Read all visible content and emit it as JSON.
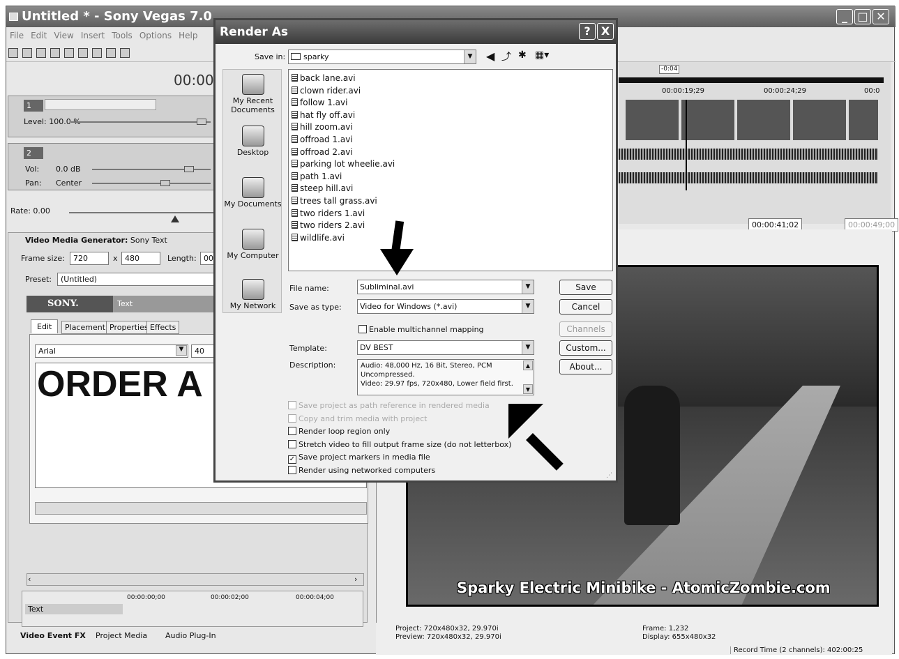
{
  "window": {
    "title": "Untitled * - Sony Vegas 7.0",
    "menu": [
      "File",
      "Edit",
      "View",
      "Insert",
      "Tools",
      "Options",
      "Help"
    ]
  },
  "timeline": {
    "time": "00:00",
    "loop_marker": "-0:04",
    "ruler": [
      "00:00:19;29",
      "00:00:24;29",
      "00:0"
    ],
    "time_end": "00:00:41;02",
    "time_length": "00:00:49;00",
    "rate": "Rate: 0.00"
  },
  "track1": {
    "num": "1",
    "level": "Level: 100.0 %"
  },
  "track2": {
    "num": "2",
    "vol_label": "Vol:",
    "vol": "0.0 dB",
    "pan_label": "Pan:",
    "pan": "Center"
  },
  "generator": {
    "title_bold": "Video Media Generator:",
    "title_rest": "Sony Text",
    "frame_label": "Frame size:",
    "frame_w": "720",
    "x": "x",
    "frame_h": "480",
    "length_label": "Length:",
    "length": "00:",
    "preset_label": "Preset:",
    "preset": "(Untitled)",
    "brand": "SONY.",
    "brand_tab": "Text",
    "tabs": [
      "Edit",
      "Placement",
      "Properties",
      "Effects"
    ],
    "font": "Arial",
    "size": "40",
    "preview_text": "ORDER A"
  },
  "mini_timeline": {
    "ruler": [
      "00:00:00;00",
      "00:00:02;00",
      "00:00:04;00"
    ],
    "track": "Text"
  },
  "bottom_tabs": [
    "Video Event FX",
    "Project Media",
    "Audio Plug-In"
  ],
  "preview": {
    "project": "Project:  720x480x32, 29.970i",
    "preview": "Preview:  720x480x32, 29.970i",
    "frame": "Frame:   1,232",
    "display": "Display:  655x480x32",
    "caption": "Sparky Electric Minibike - AtomicZombie.com",
    "status": "Record Time (2 channels): 402:00:25"
  },
  "dialog": {
    "title": "Render As",
    "help": "?",
    "close": "X",
    "save_in_label": "Save in:",
    "save_in": "sparky",
    "places": [
      "My Recent Documents",
      "Desktop",
      "My Documents",
      "My Computer",
      "My Network"
    ],
    "files": [
      "back lane.avi",
      "clown rider.avi",
      "follow 1.avi",
      "hat fly off.avi",
      "hill zoom.avi",
      "offroad 1.avi",
      "offroad 2.avi",
      "parking lot wheelie.avi",
      "path 1.avi",
      "steep hill.avi",
      "trees tall grass.avi",
      "two riders 1.avi",
      "two riders 2.avi",
      "wildlife.avi"
    ],
    "file_name_label": "File name:",
    "file_name": "Subliminal.avi",
    "save_type_label": "Save as type:",
    "save_type": "Video for Windows (*.avi)",
    "multichannel": "Enable multichannel mapping",
    "template_label": "Template:",
    "template": "DV BEST",
    "description_label": "Description:",
    "description": [
      "Audio: 48,000 Hz, 16 Bit, Stereo, PCM",
      "Uncompressed.",
      "Video: 29.97 fps, 720x480, Lower field first."
    ],
    "buttons": {
      "save": "Save",
      "cancel": "Cancel",
      "channels": "Channels",
      "custom": "Custom...",
      "about": "About..."
    },
    "options": [
      {
        "label": "Save project as path reference in rendered media",
        "checked": false,
        "disabled": true
      },
      {
        "label": "Copy and trim media with project",
        "checked": false,
        "disabled": true
      },
      {
        "label": "Render loop region only",
        "checked": false,
        "disabled": false
      },
      {
        "label": "Stretch video to fill output frame size (do not letterbox)",
        "checked": false,
        "disabled": false
      },
      {
        "label": "Save project markers in media file",
        "checked": true,
        "disabled": false
      },
      {
        "label": "Render using networked computers",
        "checked": false,
        "disabled": false
      }
    ]
  }
}
